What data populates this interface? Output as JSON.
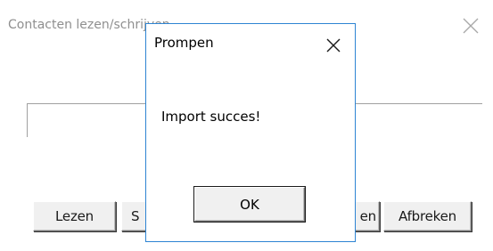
{
  "background_window": {
    "title": "Contacten lezen/schrijven",
    "buttons": {
      "lezen": "Lezen",
      "schrijven_partial": "S",
      "opslaan_partial": "en",
      "afbreken": "Afbreken"
    },
    "close_icon": "close-icon"
  },
  "dialog": {
    "title": "Prompen",
    "message": "Import succes!",
    "ok_label": "OK",
    "close_icon": "close-icon",
    "border_color": "#2d84d3"
  }
}
